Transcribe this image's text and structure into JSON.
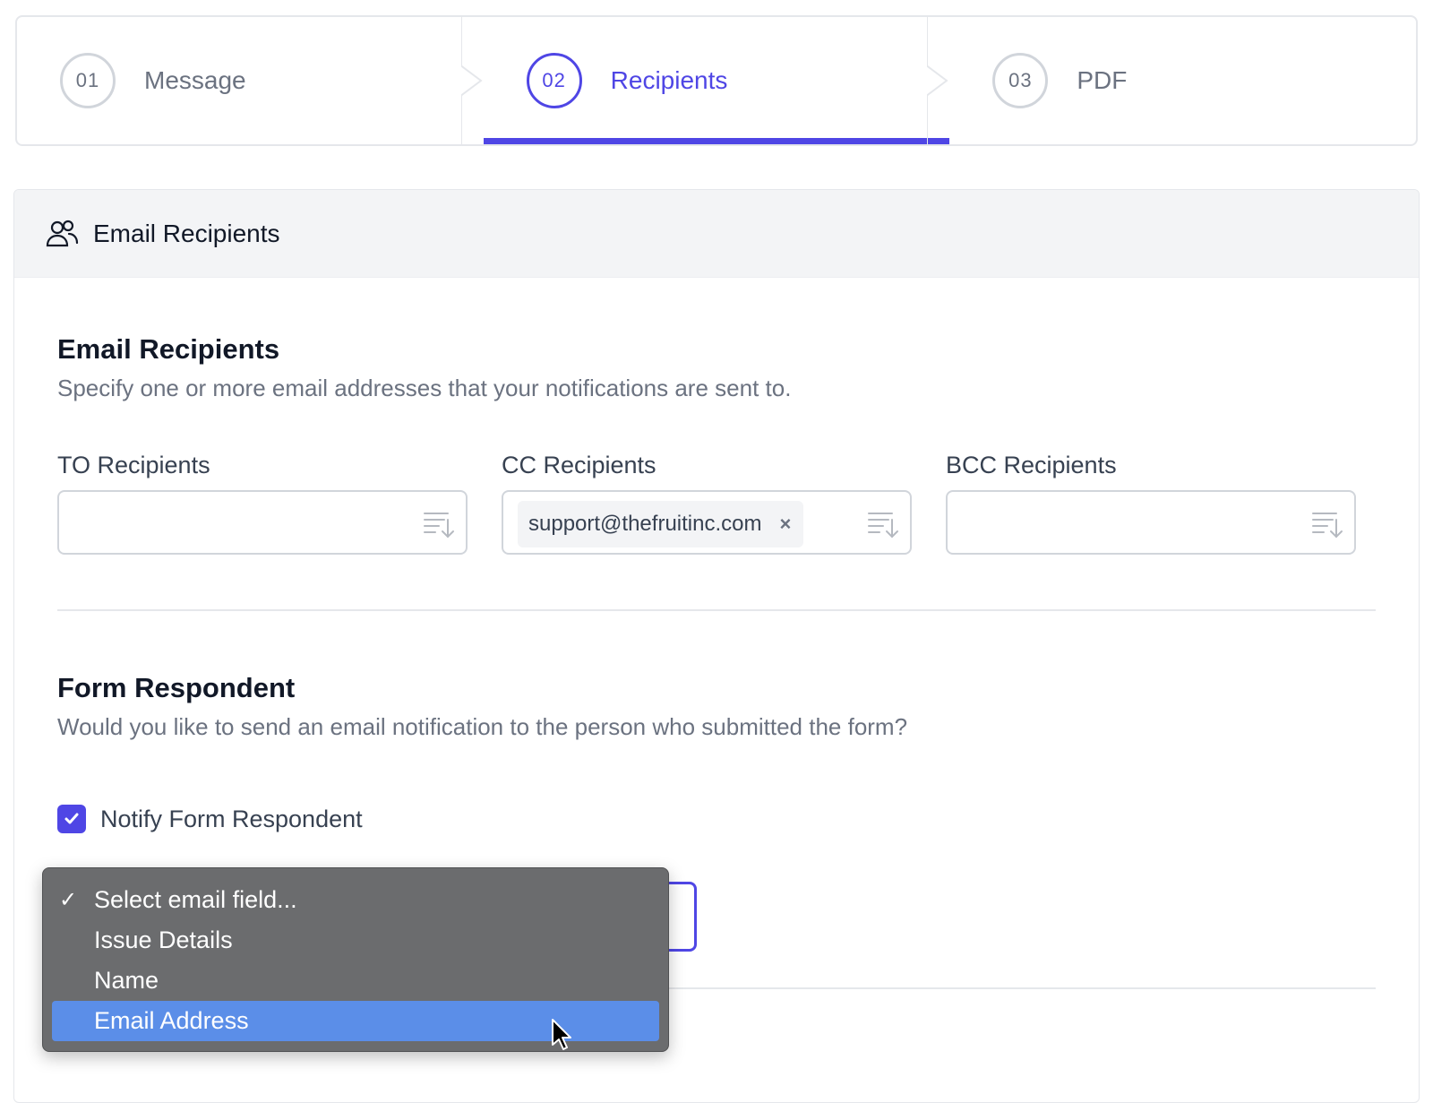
{
  "stepper": {
    "steps": [
      {
        "number": "01",
        "label": "Message",
        "active": false
      },
      {
        "number": "02",
        "label": "Recipients",
        "active": true
      },
      {
        "number": "03",
        "label": "PDF",
        "active": false
      }
    ]
  },
  "panel": {
    "header_icon": "users-icon",
    "header_title": "Email Recipients"
  },
  "email_recipients": {
    "title": "Email Recipients",
    "description": "Specify one or more email addresses that your notifications are sent to.",
    "to": {
      "label": "TO Recipients",
      "chips": []
    },
    "cc": {
      "label": "CC Recipients",
      "chips": [
        "support@thefruitinc.com"
      ]
    },
    "bcc": {
      "label": "BCC Recipients",
      "chips": []
    },
    "chip_remove_glyph": "×"
  },
  "form_respondent": {
    "title": "Form Respondent",
    "description": "Would you like to send an email notification to the person who submitted the form?",
    "notify_label": "Notify Form Respondent",
    "notify_checked": true,
    "email_field_select": {
      "selected": "Select email field...",
      "options": [
        "Select email field...",
        "Issue Details",
        "Name",
        "Email Address"
      ],
      "highlighted": "Email Address",
      "checkmark": "✓"
    }
  },
  "colors": {
    "accent": "#4f46e5",
    "dropdown_bg": "#6b6c6e",
    "dropdown_highlight": "#5b8ee8"
  }
}
